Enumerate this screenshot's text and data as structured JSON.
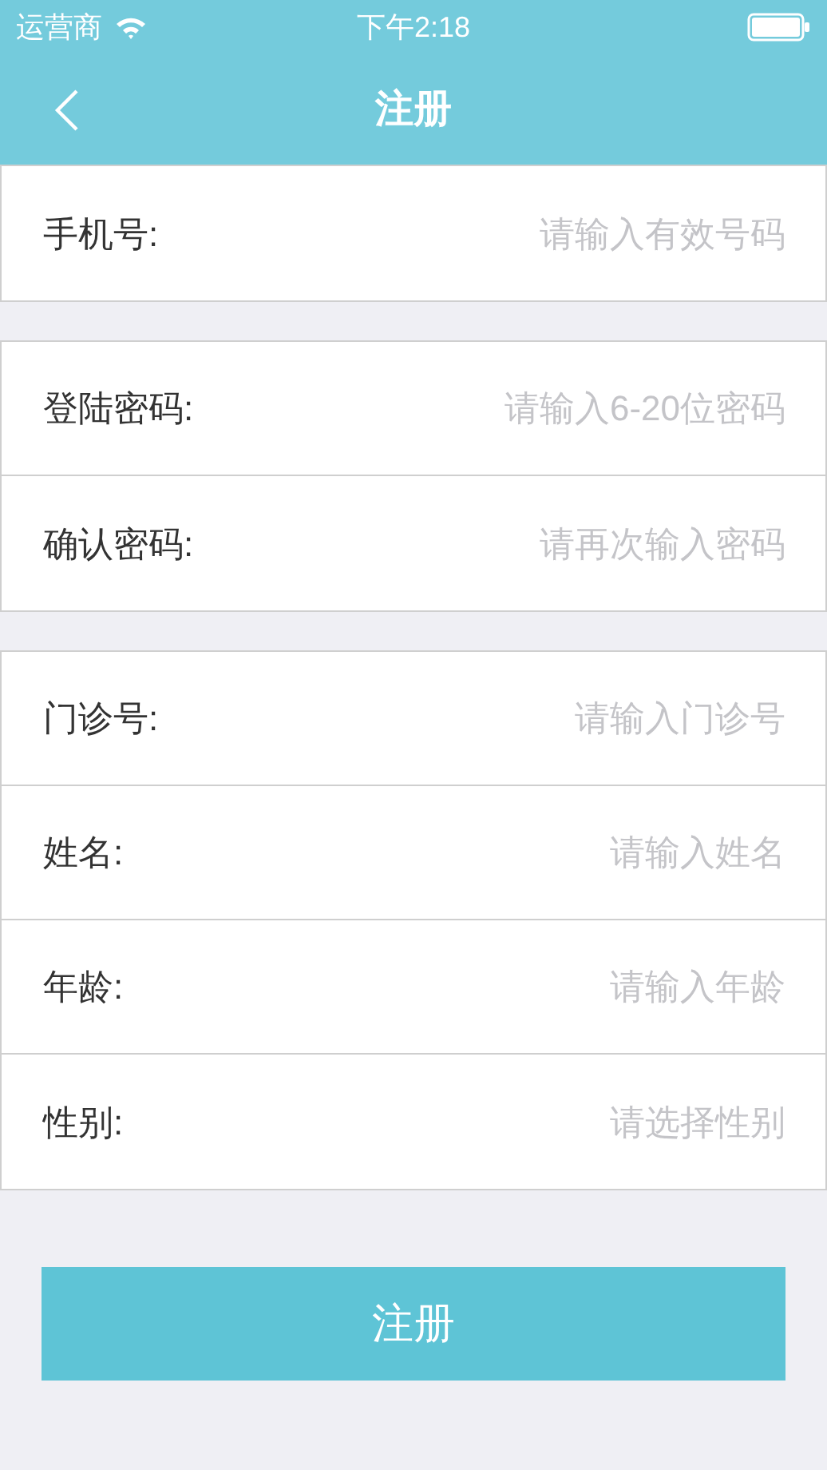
{
  "status_bar": {
    "carrier": "运营商",
    "time": "下午2:18"
  },
  "nav_bar": {
    "title": "注册"
  },
  "groups": [
    {
      "fields": [
        {
          "label": "手机号:",
          "placeholder": "请输入有效号码"
        }
      ]
    },
    {
      "fields": [
        {
          "label": "登陆密码:",
          "placeholder": "请输入6-20位密码"
        },
        {
          "label": "确认密码:",
          "placeholder": "请再次输入密码"
        }
      ]
    },
    {
      "fields": [
        {
          "label": "门诊号:",
          "placeholder": "请输入门诊号"
        },
        {
          "label": "姓名:",
          "placeholder": "请输入姓名"
        },
        {
          "label": "年龄:",
          "placeholder": "请输入年龄"
        },
        {
          "label": "性别:",
          "placeholder": "请选择性别"
        }
      ]
    }
  ],
  "submit_button": "注册"
}
